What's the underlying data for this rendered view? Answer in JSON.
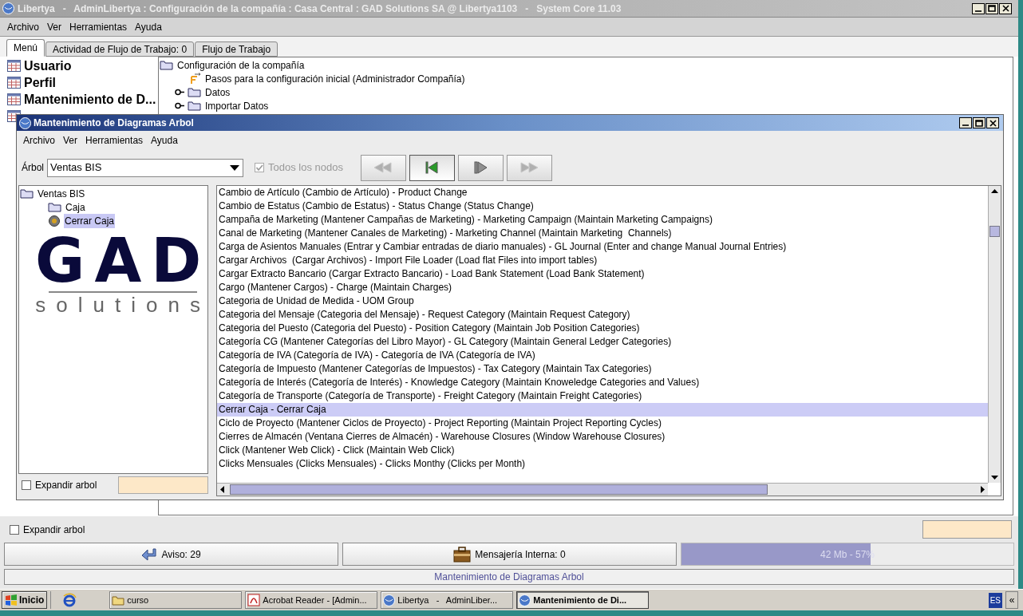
{
  "window": {
    "title": "Libertya   -   AdminLibertya : Configuración de la compañía : Casa Central : GAD Solutions SA @ Libertya1103   -   System Core 11.03"
  },
  "menu": [
    "Archivo",
    "Ver",
    "Herramientas",
    "Ayuda"
  ],
  "tabs": [
    {
      "label": "Menú",
      "selected": true
    },
    {
      "label": "Actividad de Flujo de Trabajo: 0",
      "selected": false
    },
    {
      "label": "Flujo de Trabajo",
      "selected": false
    }
  ],
  "favorites": [
    "Usuario",
    "Perfil",
    "Mantenimiento de D..."
  ],
  "tree": [
    {
      "label": "Configuración de la compañía",
      "kind": "folder",
      "expanded": true,
      "children": [
        {
          "label": "Pasos para la configuración inicial (Administrador Compañía)",
          "kind": "workflow"
        },
        {
          "label": "Datos",
          "kind": "folder",
          "expanded": false
        },
        {
          "label": "Importar Datos",
          "kind": "folder",
          "expanded": false
        }
      ]
    }
  ],
  "expand_tree": {
    "label": "Expandir arbol",
    "checked": false
  },
  "status_buttons": [
    {
      "label": "Aviso: 29",
      "kind": "notice"
    },
    {
      "label": "Mensajería Interna: 0",
      "kind": "mail"
    }
  ],
  "memory": {
    "reading": "42 Mb - 57%",
    "level": 0.57
  },
  "status_line": "Mantenimiento de Diagramas Arbol",
  "dialog": {
    "title": "Mantenimiento de Diagramas Arbol",
    "menu": [
      "Archivo",
      "Ver",
      "Herramientas",
      "Ayuda"
    ],
    "tree_label": "Árbol",
    "tree_value": "Ventas BIS",
    "all_nodes": {
      "label": "Todos los nodos",
      "checked": true,
      "disabled": true
    },
    "nav_buttons": [
      {
        "kind": "first",
        "disabled": true
      },
      {
        "kind": "previous",
        "disabled": false
      },
      {
        "kind": "next",
        "disabled": false
      },
      {
        "kind": "last",
        "disabled": true
      }
    ],
    "tree": [
      {
        "label": "Ventas BIS",
        "kind": "folder",
        "selected": false,
        "children": [
          {
            "label": "Caja",
            "kind": "folder",
            "selected": false
          },
          {
            "label": "Cerrar Caja",
            "kind": "process",
            "selected": true
          }
        ]
      }
    ],
    "logo": {
      "mark": "GAD",
      "tagline": "solutions"
    },
    "expand_tree": {
      "label": "Expandir arbol",
      "checked": false
    },
    "items": [
      {
        "label": "Cambio de Artículo (Cambio de Artículo) - Product Change",
        "selected": false
      },
      {
        "label": "Cambio de Estatus (Cambio de Estatus) - Status Change (Status Change)",
        "selected": false
      },
      {
        "label": "Campaña de Marketing (Mantener Campañas de Marketing) - Marketing Campaign (Maintain Marketing Campaigns)",
        "selected": false
      },
      {
        "label": "Canal de Marketing (Mantener Canales de Marketing) - Marketing Channel (Maintain Marketing  Channels)",
        "selected": false
      },
      {
        "label": "Carga de Asientos Manuales (Entrar y Cambiar entradas de diario manuales) - GL Journal (Enter and change Manual Journal Entries)",
        "selected": false
      },
      {
        "label": "Cargar Archivos  (Cargar Archivos) - Import File Loader (Load flat Files into import tables)",
        "selected": false
      },
      {
        "label": "Cargar Extracto Bancario (Cargar Extracto Bancario) - Load Bank Statement (Load Bank Statement)",
        "selected": false
      },
      {
        "label": "Cargo (Mantener Cargos) - Charge (Maintain Charges)",
        "selected": false
      },
      {
        "label": "Categoria de Unidad de Medida - UOM Group",
        "selected": false
      },
      {
        "label": "Categoria del Mensaje (Categoria del Mensaje) - Request Category (Maintain Request Category)",
        "selected": false
      },
      {
        "label": "Categoria del Puesto (Categoria del Puesto) - Position Category (Maintain Job Position Categories)",
        "selected": false
      },
      {
        "label": "Categoría CG (Mantener Categorías del Libro Mayor) - GL Category (Maintain General Ledger Categories)",
        "selected": false
      },
      {
        "label": "Categoría de IVA (Categoría de IVA) - Categoría de IVA (Categoría de IVA)",
        "selected": false
      },
      {
        "label": "Categoría de Impuesto (Mantener Categorías de Impuestos) - Tax Category (Maintain Tax Categories)",
        "selected": false
      },
      {
        "label": "Categoría de Interés (Categoría de Interés) - Knowledge Category (Maintain Knoweledge Categories and Values)",
        "selected": false
      },
      {
        "label": "Categoría de Transporte (Categoría de Transporte) - Freight Category (Maintain Freight Categories)",
        "selected": false
      },
      {
        "label": "Cerrar Caja - Cerrar Caja",
        "selected": true
      },
      {
        "label": "Ciclo de Proyecto (Mantener Ciclos de Proyecto) - Project Reporting (Maintain Project Reporting Cycles)",
        "selected": false
      },
      {
        "label": "Cierres de Almacén (Ventana Cierres de Almacén) - Warehouse Closures (Window Warehouse Closures)",
        "selected": false
      },
      {
        "label": "Click (Mantener Web Click) - Click (Maintain Web Click)",
        "selected": false
      },
      {
        "label": "Clicks Mensuales (Clicks Mensuales) - Clicks Monthy (Clicks per Month)",
        "selected": false
      }
    ]
  },
  "taskbar": {
    "start": "Inicio",
    "tasks": [
      {
        "label": "curso",
        "kind": "folder",
        "selected": false
      },
      {
        "label": "Acrobat Reader - [Admin...",
        "kind": "acrobat",
        "selected": false
      },
      {
        "label": "Libertya   -   AdminLiber...",
        "kind": "app",
        "selected": false
      },
      {
        "label": "Mantenimiento de Di...",
        "kind": "app",
        "selected": true
      }
    ],
    "language": "ES",
    "collapse": "«"
  }
}
